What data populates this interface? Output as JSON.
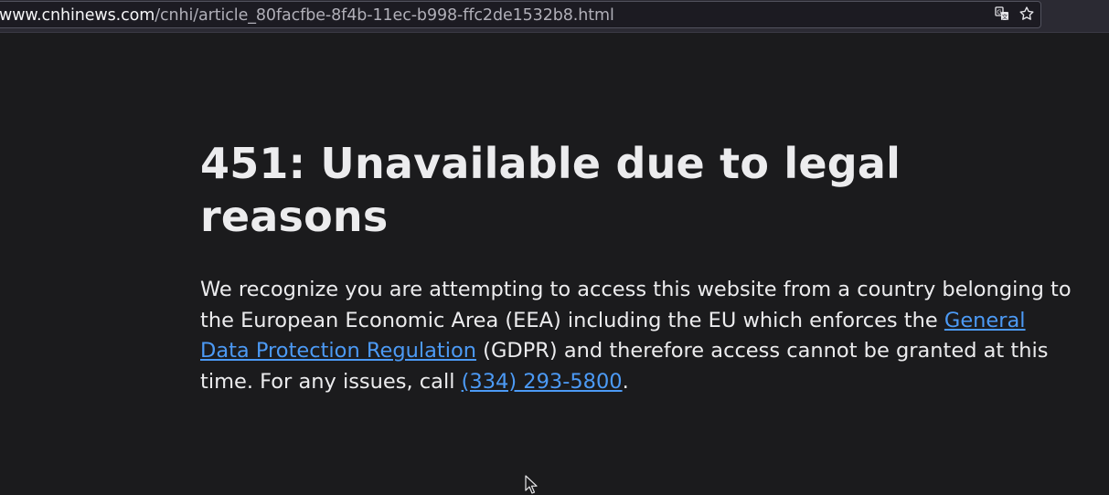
{
  "browser": {
    "url_domain": "www.cnhinews.com",
    "url_path": "/cnhi/article_80facfbe-8f4b-11ec-b998-ffc2de1532b8.html",
    "icons": [
      "translate-icon",
      "bookmark-star-icon"
    ]
  },
  "page": {
    "title": "451: Unavailable due to legal reasons",
    "body_part1": "We recognize you are attempting to access this website from a country belonging to the European Economic Area (EEA) including the EU which enforces the ",
    "gdpr_link": "General Data Protection Regulation",
    "body_part2": " (GDPR) and therefore access cannot be granted at this time. For any issues, call ",
    "phone_link": "(334) 293-5800",
    "body_part3": "."
  },
  "colors": {
    "background": "#1b1b1d",
    "text": "#ececee",
    "link": "#4c9af5"
  }
}
